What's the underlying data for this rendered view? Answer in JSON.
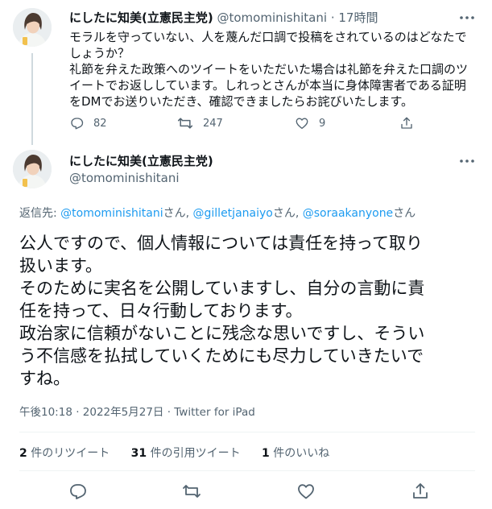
{
  "parent_tweet": {
    "display_name": "にしたに知美(立憲民主党)",
    "handle": "@tomominishitani",
    "separator": "·",
    "time": "17時間",
    "text_lines": [
      "モラルを守っていない、人を蔑んだ口調で投稿をされているのはどなたで",
      "しょうか？",
      "礼節を弁えた政策へのツイートをいただいた場合は礼節を弁えた口調のツ",
      "イートでお返ししています。しれっとさんが本当に身体障害者である証明",
      "をDMでお送りいただき、確認できましたらお詫びいたします。"
    ],
    "reply_count": "82",
    "retweet_count": "247",
    "like_count": "9",
    "icons": [
      "reply-icon",
      "retweet-icon",
      "like-icon",
      "share-icon",
      "more-icon"
    ]
  },
  "main_tweet": {
    "display_name": "にしたに知美(立憲民主党)",
    "handle": "@tomominishitani",
    "reply_to": {
      "prefix": "返信先: ",
      "mention1": "@tomominishitani",
      "suffix1": "さん, ",
      "mention2": "@gilletjanaiyo",
      "suffix2": "さん, ",
      "mention3": "@soraakanyone",
      "suffix3": "さん"
    },
    "text_lines": [
      "公人ですので、個人情報については責任を持って取り",
      "扱います。",
      "そのために実名を公開していますし、自分の言動に責",
      "任を持って、日々行動しております。",
      "政治家に信頼がないことに残念な思いですし、そうい",
      "う不信感を払拭していくためにも尽力していきたいで",
      "すね。"
    ],
    "timestamp": "午後10:18 · 2022年5月27日 · Twitter for iPad",
    "stats": {
      "retweets_value": "2",
      "retweets_label": " 件のリツイート",
      "quotes_value": "31",
      "quotes_label": " 件の引用ツイート",
      "likes_value": "1",
      "likes_label": " 件のいいね"
    }
  },
  "colors": {
    "text": "#0f1419",
    "secondary": "#536471",
    "accent": "#1d9bf0",
    "divider": "#eff3f4",
    "thread_line": "#cfd9de"
  }
}
